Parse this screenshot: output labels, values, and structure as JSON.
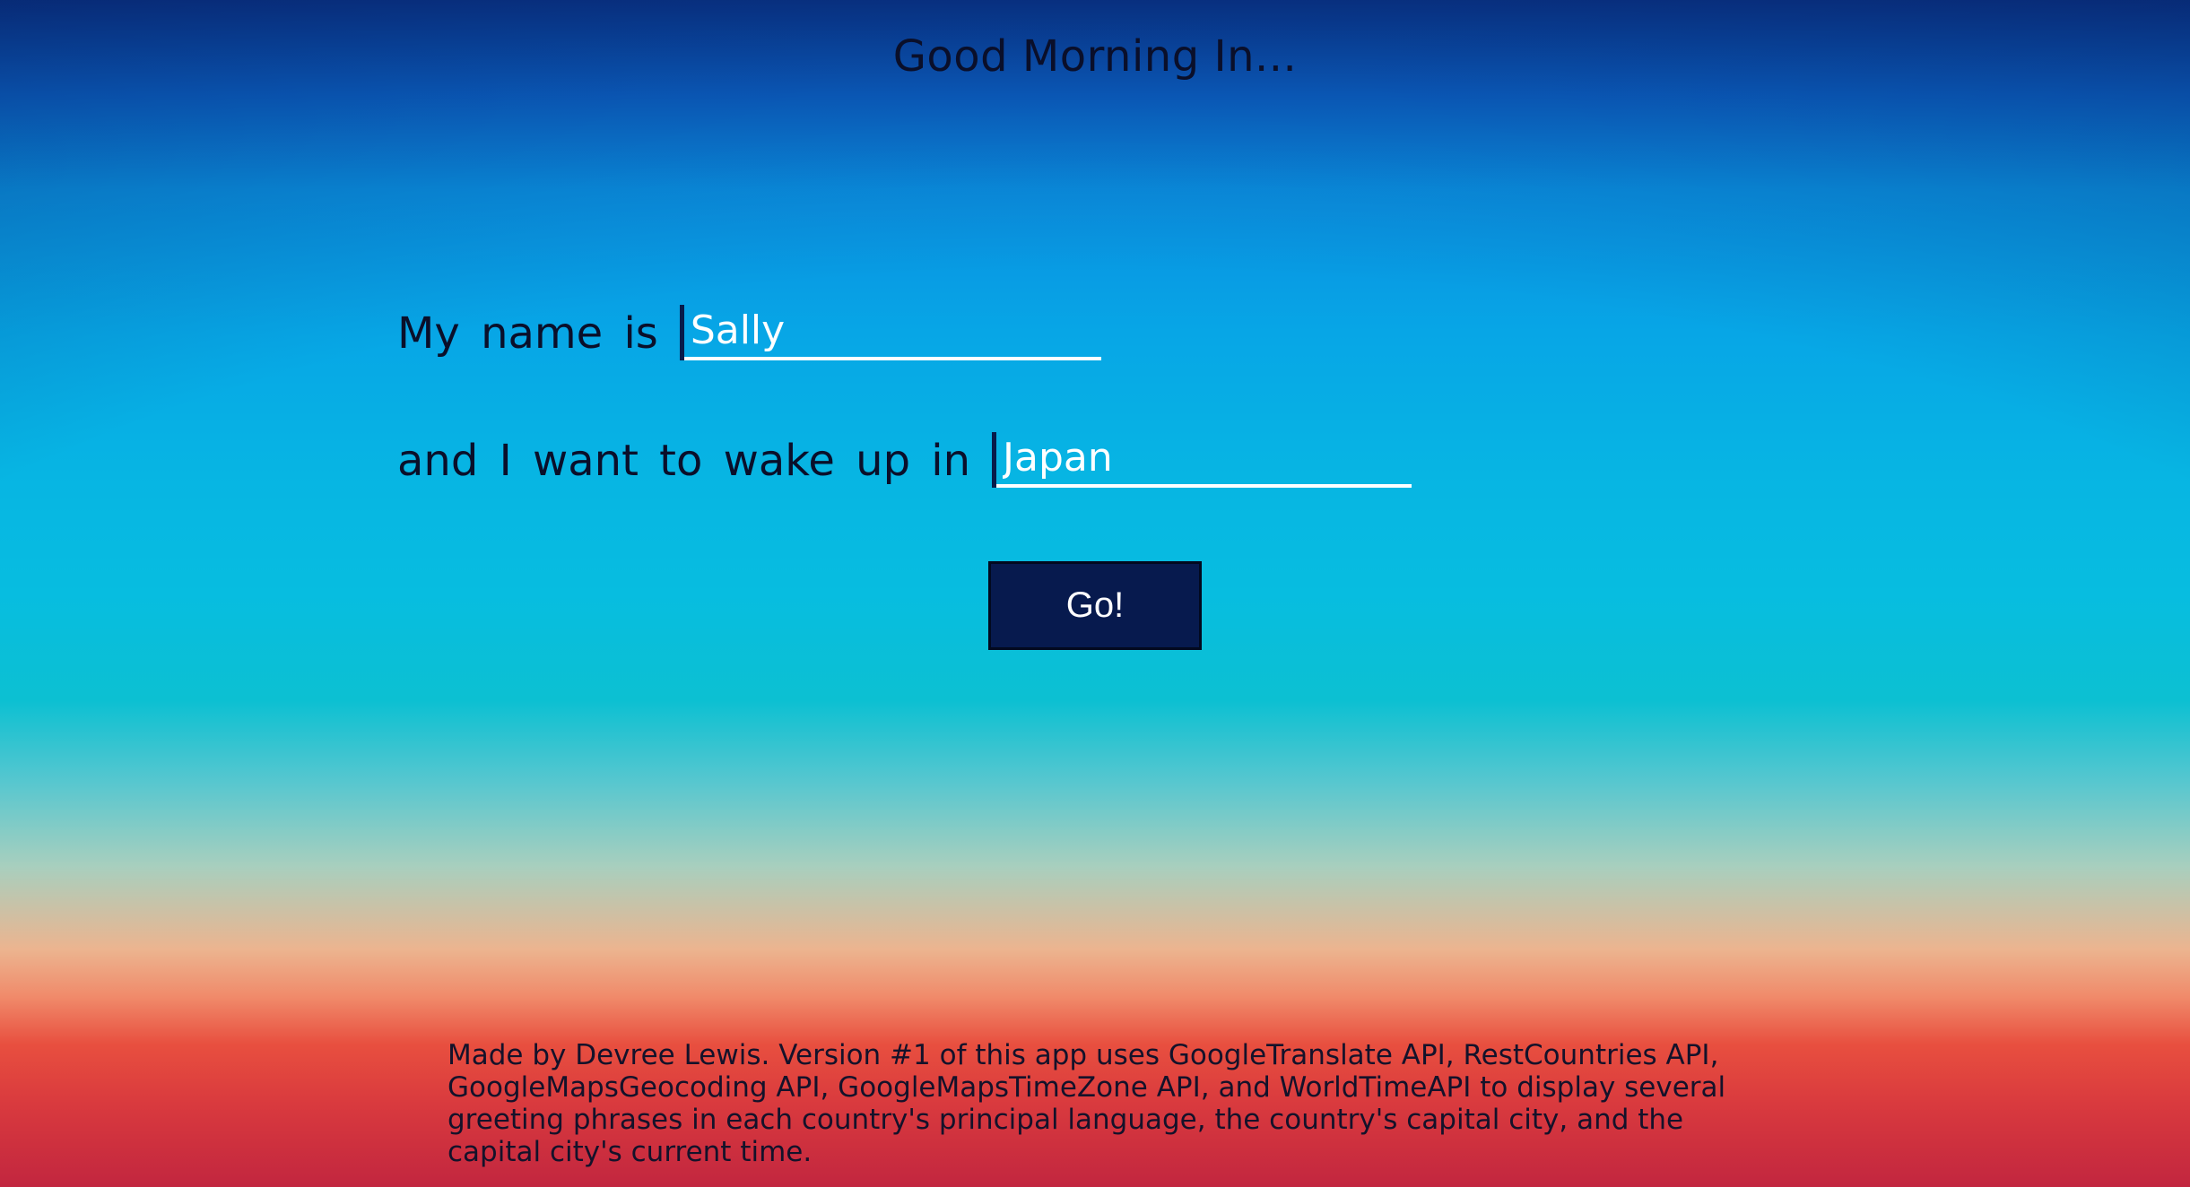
{
  "header": {
    "title": "Good Morning In..."
  },
  "form": {
    "name_label": "My name is",
    "name_value": "Sally",
    "country_label": "and I want to wake up in",
    "country_value": "Japan",
    "submit_label": "Go!"
  },
  "footer": {
    "text": "Made by Devree Lewis. Version #1 of this app uses GoogleTranslate API, RestCountries API, GoogleMapsGeocoding API, GoogleMapsTimeZone API, and WorldTimeAPI to display several greeting phrases in each country's principal language, the country's capital city, and the capital city's current time."
  },
  "colors": {
    "input_text": "#ffffff",
    "input_underline": "#ffffff",
    "button_bg": "#071a4e",
    "text": "#0a0f2a"
  }
}
